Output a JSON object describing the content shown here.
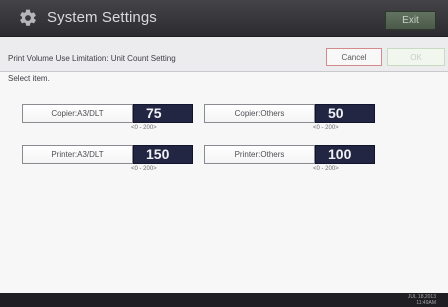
{
  "window": {
    "title": "System Settings",
    "exit_label": "Exit"
  },
  "screen": {
    "setting_title": "Print Volume Use Limitation: Unit Count Setting",
    "cancel_label": "Cancel",
    "ok_label": "OK",
    "instruction": "Select item."
  },
  "items": {
    "copier_a3_dlt": {
      "label": "Copier:A3/DLT",
      "value": "75",
      "range": "<0 - 200>"
    },
    "copier_others": {
      "label": "Copier:Others",
      "value": "50",
      "range": "<0 - 200>"
    },
    "printer_a3_dlt": {
      "label": "Printer:A3/DLT",
      "value": "150",
      "range": "<0 - 200>"
    },
    "printer_others": {
      "label": "Printer:Others",
      "value": "100",
      "range": "<0 - 200>"
    }
  },
  "status": {
    "date": "JUL 18,2013",
    "time": "11:49AM"
  },
  "colors": {
    "title_bar": "#333337",
    "value_box": "#232642",
    "cancel_border": "#d48b8b",
    "ok_disabled": "#c5d1c0",
    "exit_button": "#566555"
  },
  "icons": {
    "settings": "gear-icon"
  }
}
